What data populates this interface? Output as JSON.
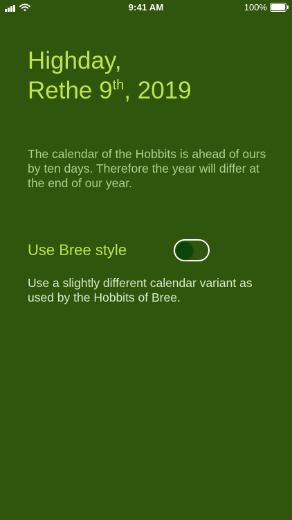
{
  "status_bar": {
    "time": "9:41 AM",
    "battery_percent": "100%",
    "battery_level": 1.0,
    "signal_icon": "cellular-signal-icon",
    "wifi_icon": "wifi-icon",
    "battery_icon": "battery-icon"
  },
  "date": {
    "line1": "Highday,",
    "month": "Rethe",
    "day": "9",
    "ordinal": "th",
    "year": ", 2019"
  },
  "description": "The calendar of the Hobbits is ahead of ours by ten days. Therefore the year will differ at the end of our year.",
  "bree_setting": {
    "label": "Use Bree style",
    "enabled": false,
    "description": "Use a slightly different calendar variant as used by the Hobbits of Bree."
  },
  "colors": {
    "background": "#30560d",
    "heading": "#bde64a",
    "description": "#a5d18d",
    "toggle_label": "#b9e447",
    "toggle_knob": "#0a450c",
    "secondary_text": "#d6ebcc"
  }
}
